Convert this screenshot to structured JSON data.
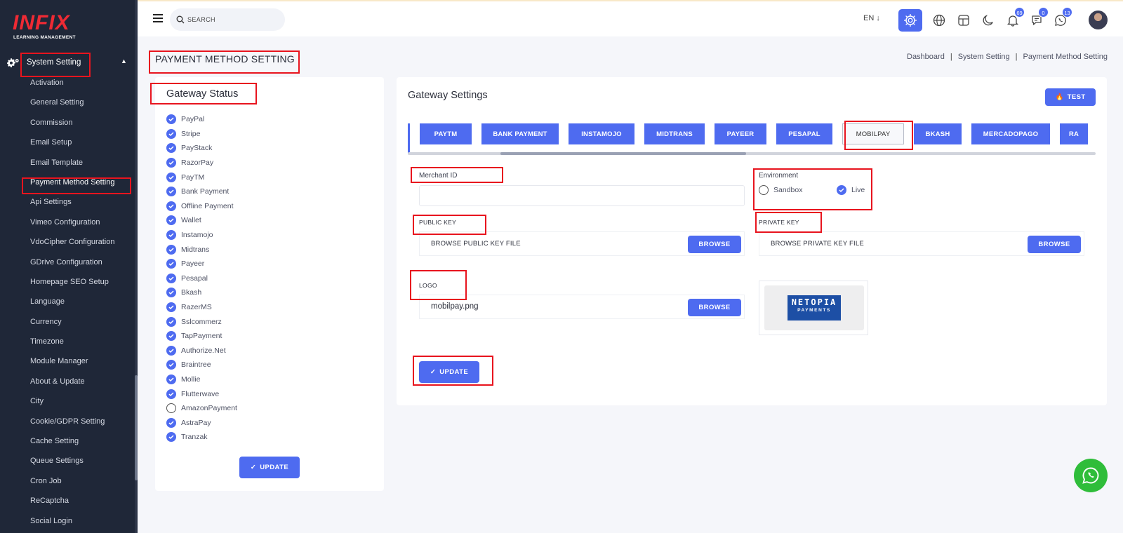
{
  "sidebar": {
    "brand": "INFIX",
    "brand_sub": "LEARNING MANAGEMENT",
    "parent_label": "System Setting",
    "items": [
      {
        "label": "Activation"
      },
      {
        "label": "General Setting"
      },
      {
        "label": "Commission"
      },
      {
        "label": "Email Setup"
      },
      {
        "label": "Email Template"
      },
      {
        "label": "Payment Method Setting"
      },
      {
        "label": "Api Settings"
      },
      {
        "label": "Vimeo Configuration"
      },
      {
        "label": "VdoCipher Configuration"
      },
      {
        "label": "GDrive Configuration"
      },
      {
        "label": "Homepage SEO Setup"
      },
      {
        "label": "Language"
      },
      {
        "label": "Currency"
      },
      {
        "label": "Timezone"
      },
      {
        "label": "Module Manager"
      },
      {
        "label": "About & Update"
      },
      {
        "label": "City"
      },
      {
        "label": "Cookie/GDPR Setting"
      },
      {
        "label": "Cache Setting"
      },
      {
        "label": "Queue Settings"
      },
      {
        "label": "Cron Job"
      },
      {
        "label": "ReCaptcha"
      },
      {
        "label": "Social Login"
      }
    ]
  },
  "topbar": {
    "search_placeholder": "SEARCH",
    "language": "EN",
    "notifications_count": "69",
    "messages_count": "0",
    "whatsapp_count": "13"
  },
  "page": {
    "title": "PAYMENT METHOD SETTING",
    "breadcrumb": [
      "Dashboard",
      "System Setting",
      "Payment Method Setting"
    ],
    "separator": "|"
  },
  "gateway_status": {
    "title": "Gateway Status",
    "gateways": [
      {
        "name": "PayPal",
        "enabled": true
      },
      {
        "name": "Stripe",
        "enabled": true
      },
      {
        "name": "PayStack",
        "enabled": true
      },
      {
        "name": "RazorPay",
        "enabled": true
      },
      {
        "name": "PayTM",
        "enabled": true
      },
      {
        "name": "Bank Payment",
        "enabled": true
      },
      {
        "name": "Offline Payment",
        "enabled": true
      },
      {
        "name": "Wallet",
        "enabled": true
      },
      {
        "name": "Instamojo",
        "enabled": true
      },
      {
        "name": "Midtrans",
        "enabled": true
      },
      {
        "name": "Payeer",
        "enabled": true
      },
      {
        "name": "Pesapal",
        "enabled": true
      },
      {
        "name": "Bkash",
        "enabled": true
      },
      {
        "name": "RazerMS",
        "enabled": true
      },
      {
        "name": "Sslcommerz",
        "enabled": true
      },
      {
        "name": "TapPayment",
        "enabled": true
      },
      {
        "name": "Authorize.Net",
        "enabled": true
      },
      {
        "name": "Braintree",
        "enabled": true
      },
      {
        "name": "Mollie",
        "enabled": true
      },
      {
        "name": "Flutterwave",
        "enabled": true
      },
      {
        "name": "AmazonPayment",
        "enabled": false
      },
      {
        "name": "AstraPay",
        "enabled": true
      },
      {
        "name": "Tranzak",
        "enabled": true
      }
    ],
    "update_label": "UPDATE"
  },
  "gateway_settings": {
    "title": "Gateway Settings",
    "test_label": "TEST",
    "tabs": [
      {
        "label": "PAYTM"
      },
      {
        "label": "BANK PAYMENT"
      },
      {
        "label": "INSTAMOJO"
      },
      {
        "label": "MIDTRANS"
      },
      {
        "label": "PAYEER"
      },
      {
        "label": "PESAPAL"
      },
      {
        "label": "MOBILPAY"
      },
      {
        "label": "BKASH"
      },
      {
        "label": "MERCADOPAGO"
      },
      {
        "label": "RA"
      }
    ],
    "active_tab": "MOBILPAY",
    "merchant_id_label": "Merchant ID",
    "merchant_id_value": "",
    "environment_label": "Environment",
    "env_options": [
      "Sandbox",
      "Live"
    ],
    "env_selected": "Live",
    "public_key_label": "PUBLIC KEY",
    "public_key_placeholder": "BROWSE PUBLIC KEY FILE",
    "private_key_label": "PRIVATE KEY",
    "private_key_placeholder": "BROWSE PRIVATE KEY FILE",
    "browse_label": "BROWSE",
    "logo_label": "LOGO",
    "logo_file": "mobilpay.png",
    "logo_text_1": "NETOPIA",
    "logo_text_2": "PAYMENTS",
    "update_label": "UPDATE"
  },
  "colors": {
    "accent": "#4e6bf0",
    "sidebar_bg": "#1f2738",
    "highlight": "#e8141e",
    "whatsapp": "#2fbd3a"
  }
}
